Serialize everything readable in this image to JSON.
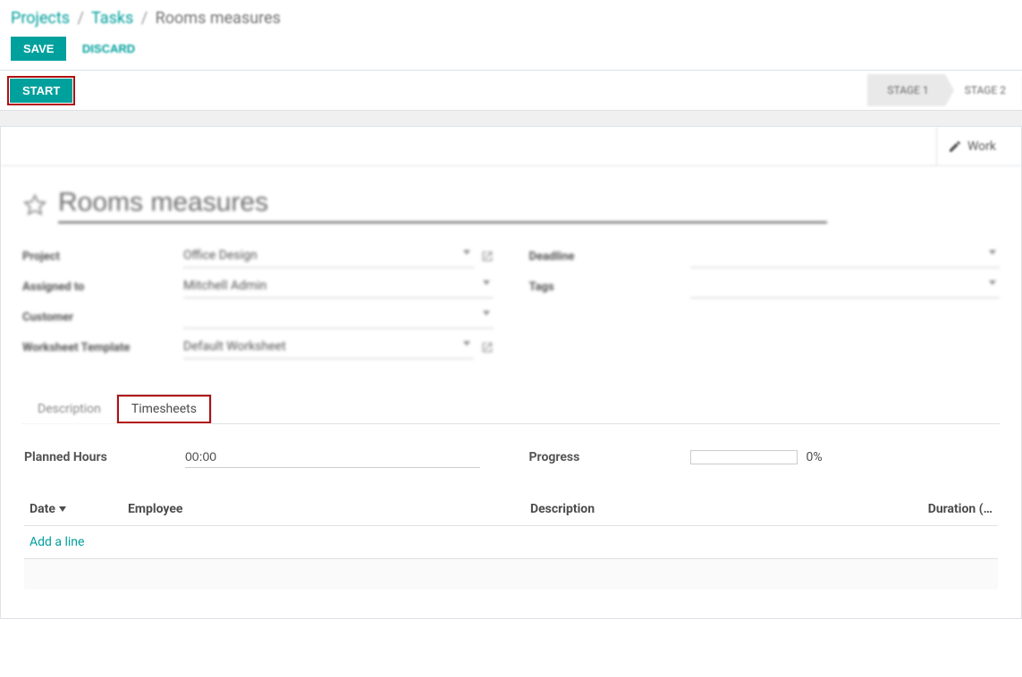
{
  "breadcrumb": {
    "projects": "Projects",
    "tasks": "Tasks",
    "current": "Rooms measures"
  },
  "buttons": {
    "save": "SAVE",
    "discard": "DISCARD",
    "start": "START"
  },
  "stages": {
    "s1": "STAGE 1",
    "s2": "STAGE 2"
  },
  "stat": {
    "worksheet": "Work"
  },
  "title": "Rooms measures",
  "fields": {
    "project_label": "Project",
    "project_value": "Office Design",
    "assigned_label": "Assigned to",
    "assigned_value": "Mitchell Admin",
    "customer_label": "Customer",
    "customer_value": "",
    "wtpl_label": "Worksheet Template",
    "wtpl_value": "Default Worksheet",
    "deadline_label": "Deadline",
    "deadline_value": "",
    "tags_label": "Tags",
    "tags_value": ""
  },
  "tabs": {
    "description": "Description",
    "timesheets": "Timesheets"
  },
  "timesheet": {
    "planned_label": "Planned Hours",
    "planned_value": "00:00",
    "progress_label": "Progress",
    "progress_pct": "0%",
    "cols": {
      "date": "Date",
      "employee": "Employee",
      "description": "Description",
      "duration": "Duration (…"
    },
    "add_line": "Add a line"
  }
}
